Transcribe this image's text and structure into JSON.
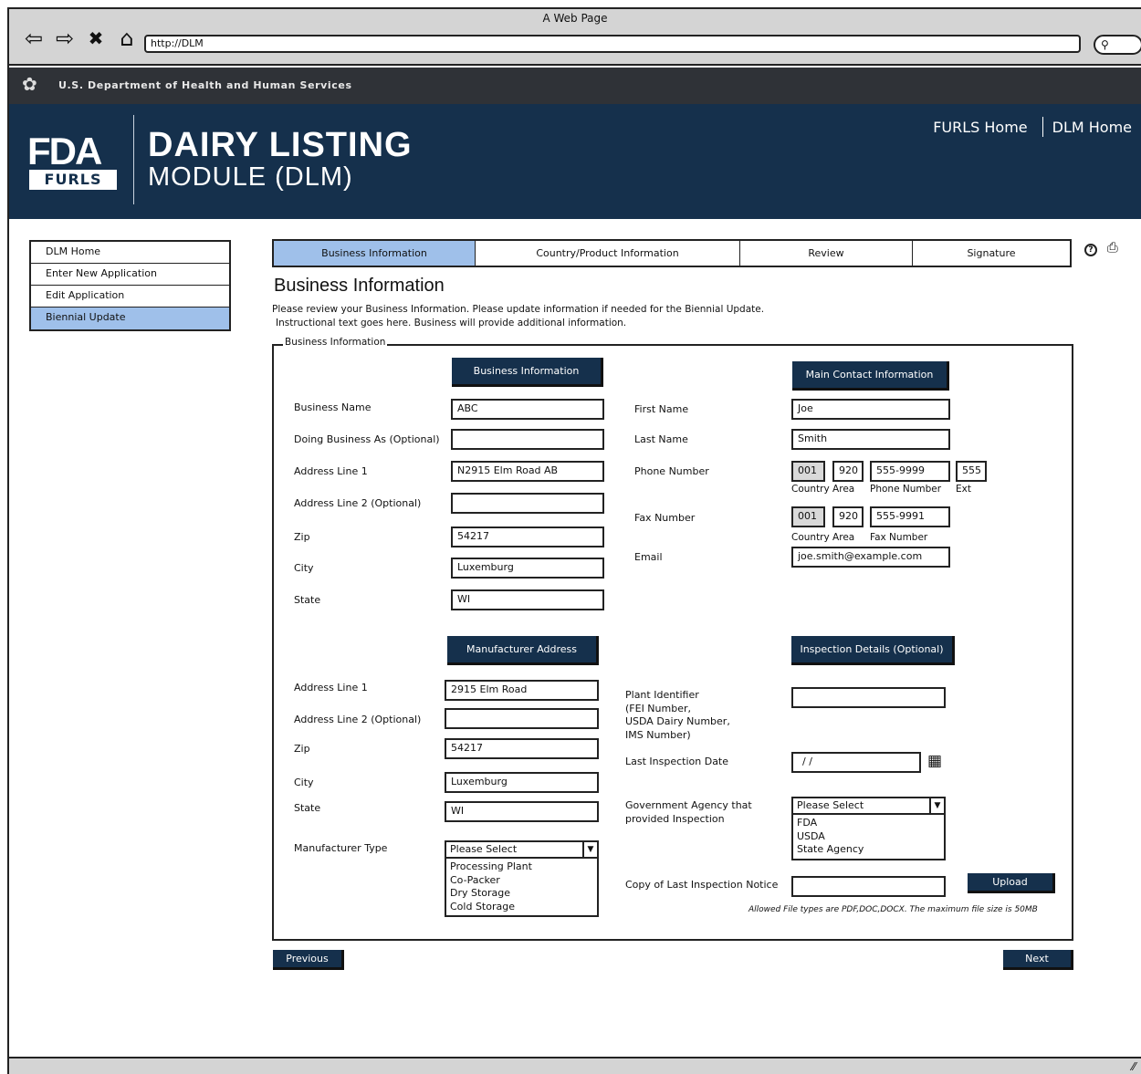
{
  "browser": {
    "window_title": "A Web Page",
    "url": "http://DLM",
    "back_icon": "⇦",
    "forward_icon": "⇨",
    "stop_icon": "✖",
    "home_icon": "⌂",
    "search_icon": "🔍"
  },
  "agency_bar": {
    "text": "U.S. Department of Health and Human Services"
  },
  "header": {
    "logo_top": "FDA",
    "logo_bottom": "FURLS",
    "title_line1": "DAIRY LISTING",
    "title_line2": "MODULE (DLM)",
    "links": [
      "FURLS Home",
      "DLM Home"
    ]
  },
  "sidebar": {
    "items": [
      {
        "label": "DLM Home"
      },
      {
        "label": "Enter New Application"
      },
      {
        "label": "Edit Application"
      },
      {
        "label": "Biennial Update"
      }
    ]
  },
  "tabs": [
    {
      "label": "Business Information"
    },
    {
      "label": "Country/Product Information"
    },
    {
      "label": "Review"
    },
    {
      "label": "Signature"
    }
  ],
  "page": {
    "title": "Business Information",
    "intro_line1": "Please review your Business Information. Please update information if needed for the Biennial Update.",
    "intro_line2": "Instructional text goes here. Business will provide additional information.",
    "fieldset_legend": "Business Information"
  },
  "business": {
    "section_label": "Business Information",
    "fields": [
      {
        "label": "Business Name",
        "value": "ABC"
      },
      {
        "label": "Doing Business As (Optional)",
        "value": ""
      },
      {
        "label": "Address Line 1",
        "value": "N2915 Elm Road AB"
      },
      {
        "label": "Address Line 2 (Optional)",
        "value": ""
      },
      {
        "label": "Zip",
        "value": "54217"
      },
      {
        "label": "City",
        "value": "Luxemburg"
      },
      {
        "label": "State",
        "value": "WI"
      }
    ]
  },
  "contact": {
    "section_label": "Main Contact Information",
    "first_name_label": "First Name",
    "first_name": "Joe",
    "last_name_label": "Last Name",
    "last_name": "Smith",
    "phone_label": "Phone Number",
    "phone_country": "001",
    "phone_area": "920",
    "phone_number": "555-9999",
    "phone_ext": "555",
    "sub_country_area": "Country Area",
    "sub_phone_number": "Phone Number",
    "sub_ext": "Ext",
    "fax_label": "Fax Number",
    "fax_country": "001",
    "fax_area": "920",
    "fax_number": "555-9991",
    "sub_fax_country_area": "Country Area",
    "sub_fax_number": "Fax Number",
    "email_label": "Email",
    "email": "joe.smith@example.com"
  },
  "manufacturer": {
    "section_label": "Manufacturer Address",
    "fields": [
      {
        "label": "Address Line 1",
        "value": "2915 Elm Road"
      },
      {
        "label": "Address Line 2 (Optional)",
        "value": ""
      },
      {
        "label": "Zip",
        "value": "54217"
      },
      {
        "label": "City",
        "value": "Luxemburg"
      },
      {
        "label": "State",
        "value": "WI"
      }
    ],
    "type_label": "Manufacturer Type",
    "type_selected": "Please Select",
    "type_options": [
      "Processing Plant",
      "Co-Packer",
      "Dry Storage",
      "Cold Storage"
    ]
  },
  "inspection": {
    "section_label": "Inspection Details (Optional)",
    "plant_id_label": "Plant Identifier\n(FEI Number,\nUSDA Dairy Number,\nIMS Number)",
    "plant_id_value": "",
    "last_date_label": "Last Inspection Date",
    "last_date_value": "/ /",
    "agency_label": "Government Agency that\n provided Inspection",
    "agency_selected": "Please Select",
    "agency_options": [
      "FDA",
      "USDA",
      "State Agency"
    ],
    "copy_label": "Copy of Last Inspection Notice",
    "copy_value": "",
    "upload_label": "Upload",
    "file_note": "Allowed File types are PDF,DOC,DOCX. The maximum file size is 50MB"
  },
  "footer_nav": {
    "previous": "Previous",
    "next": "Next"
  },
  "icons": {
    "help": "?",
    "print": "print-icon",
    "calendar": "calendar-icon"
  }
}
